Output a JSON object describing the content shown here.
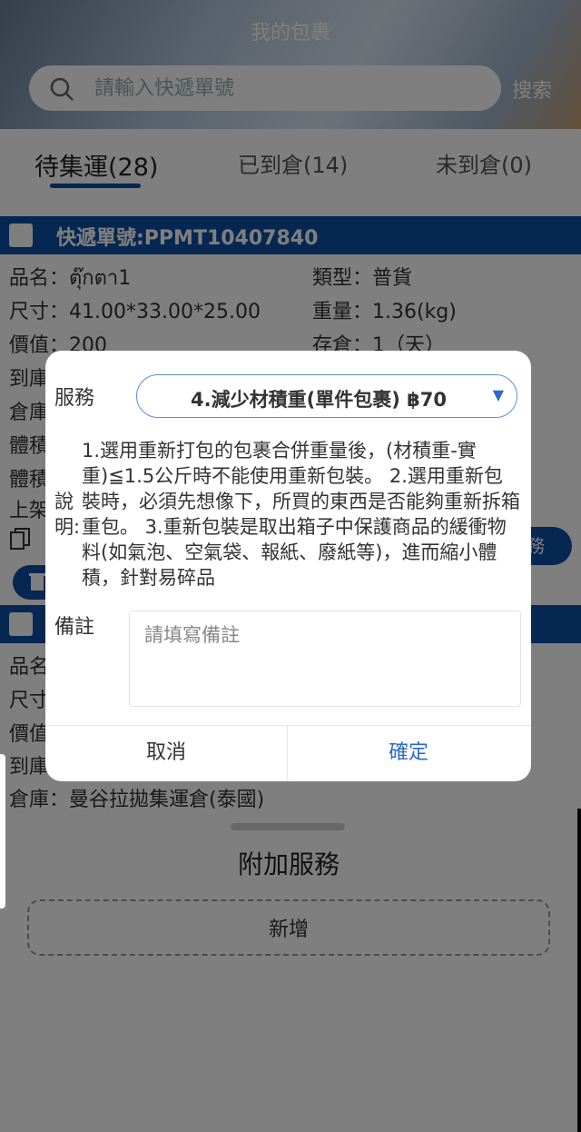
{
  "header": {
    "title": "我的包裹",
    "search_placeholder": "請輸入快遞單號",
    "search_button": "搜索"
  },
  "tabs": [
    {
      "label": "待集運(28)",
      "active": true
    },
    {
      "label": "已到倉(14)",
      "active": false
    },
    {
      "label": "未到倉(0)",
      "active": false
    }
  ],
  "parcel": {
    "tracking": "快遞單號:PPMT10407840",
    "name": "品名：ตุ๊กตา1",
    "type": "類型：普貨",
    "size": "尺寸：41.00*33.00*25.00",
    "weight": "重量：1.36(kg)",
    "value": "價值：200",
    "storage": "存倉：1（天）",
    "row_arrive": "到庫",
    "row_warehouse": "倉庫",
    "row_volume": "體積",
    "row_volume2": "體積",
    "row_shelf": "上架",
    "service_btn": "務"
  },
  "parcel2": {
    "name": "品名",
    "size": "尺寸",
    "value": "價值",
    "arrive": "到庫",
    "warehouse": "倉庫：曼谷拉拋集運倉(泰國)"
  },
  "sheet": {
    "title": "附加服務",
    "add_button": "新增"
  },
  "modal": {
    "service_label": "服務",
    "service_value": "4.減少材積重(單件包裹) ฿70",
    "desc_label": "說明:",
    "desc_text": "1.選用重新打包的包裹合併重量後，(材積重-實重)≦1.5公斤時不能使用重新包裝。 2.選用重新包裝時，必須先想像下，所買的東西是否能夠重新拆箱重包。 3.重新包裝是取出箱子中保護商品的緩衝物料(如氣泡、空氣袋、報紙、廢紙等)，進而縮小體積，針對易碎品",
    "notes_label": "備註",
    "notes_placeholder": "請填寫備註",
    "cancel": "取消",
    "confirm": "確定"
  },
  "colors": {
    "primary": "#0d4fa3",
    "link": "#2a6acb",
    "overlay": "rgba(0,0,0,0.5)"
  }
}
